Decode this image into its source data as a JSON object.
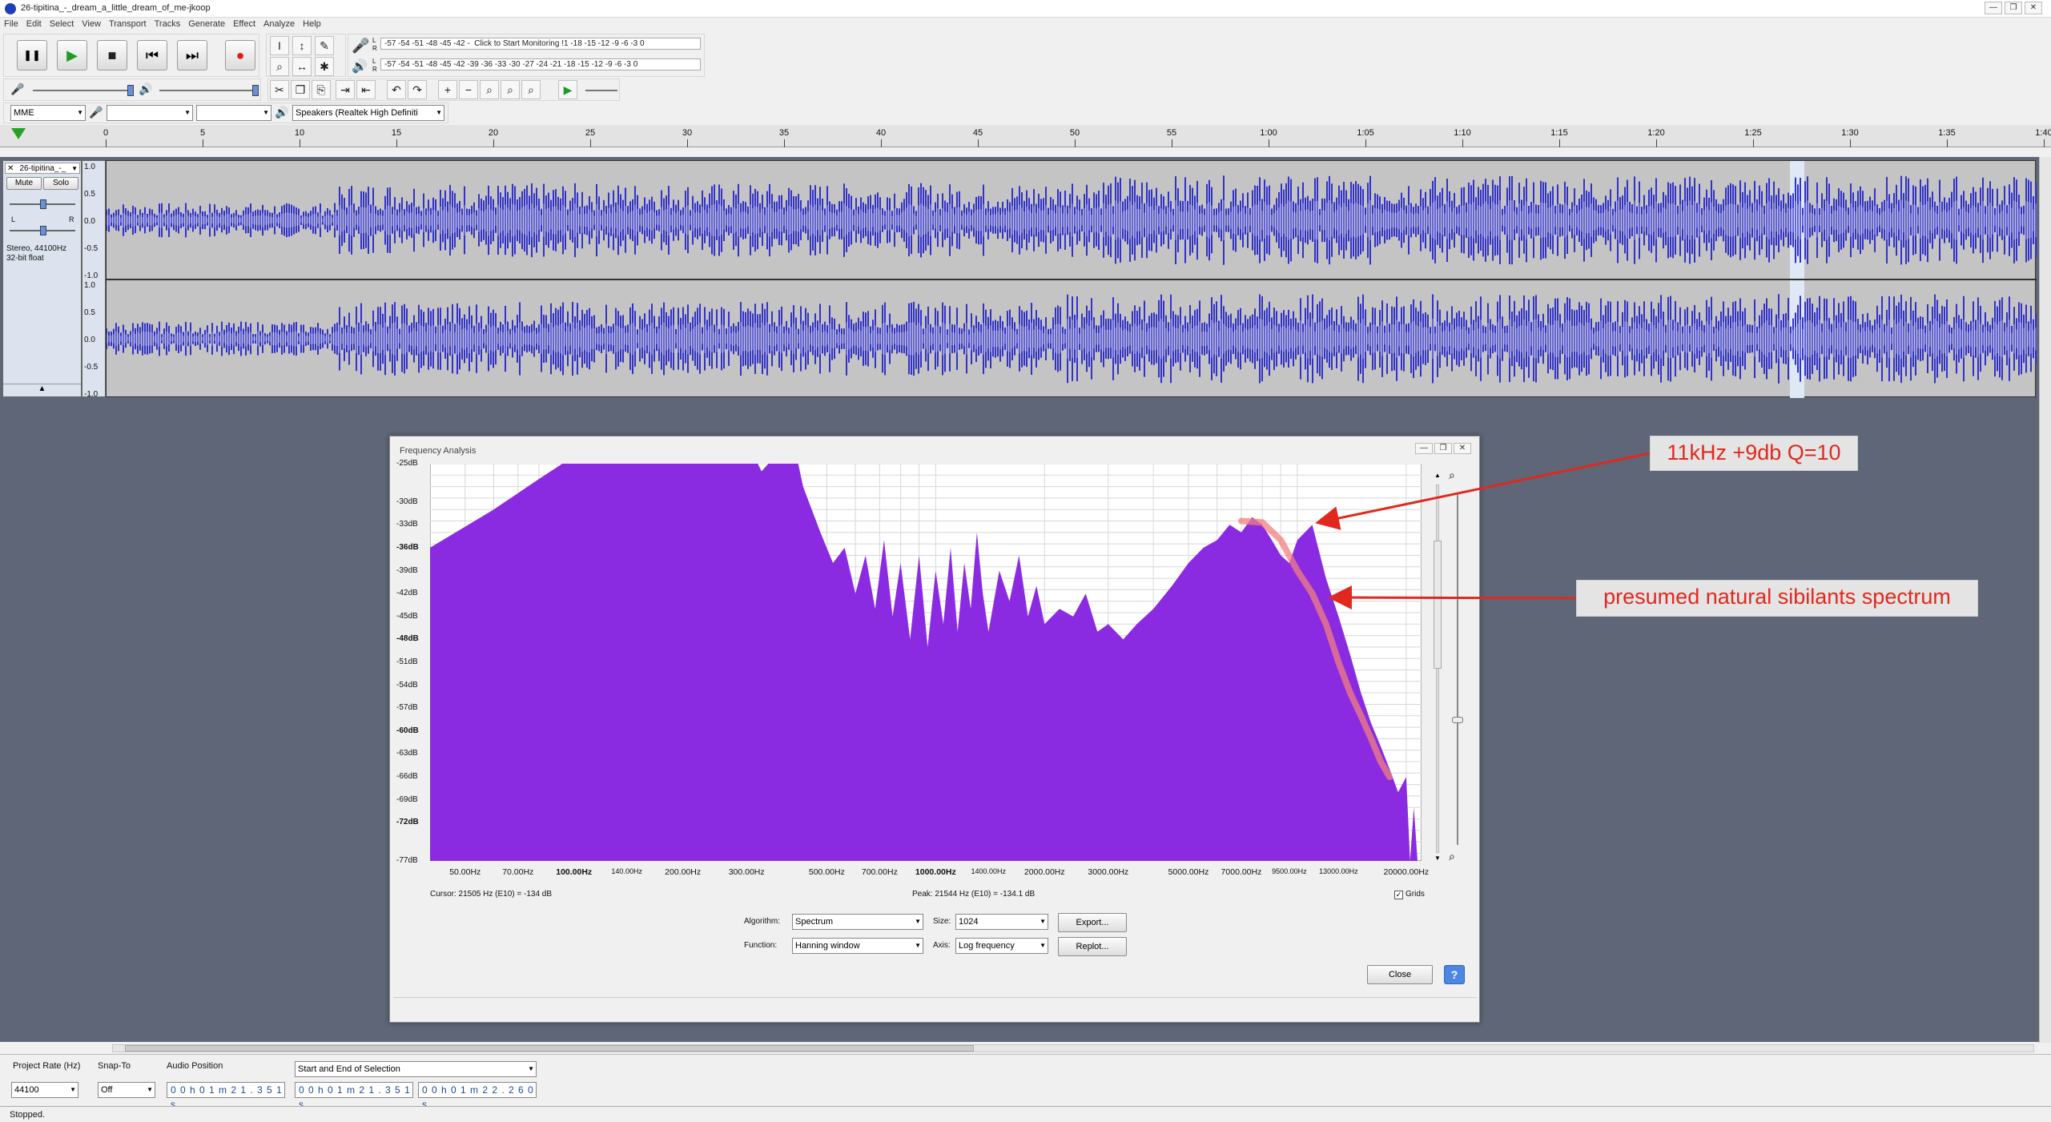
{
  "window": {
    "title": "26-tipitina_-_dream_a_little_dream_of_me-jkoop",
    "controls": [
      "—",
      "❐",
      "✕"
    ]
  },
  "menu": [
    "File",
    "Edit",
    "Select",
    "View",
    "Transport",
    "Tracks",
    "Generate",
    "Effect",
    "Analyze",
    "Help"
  ],
  "transport": {
    "pause": "❚❚",
    "play": "▶",
    "stop": "■",
    "skip_start": "⏮",
    "skip_end": "⏭",
    "record": "●"
  },
  "meters": {
    "record_scale": "-57 -54 -51 -48 -45 -42 -  Click to Start Monitoring !1 -18 -15 -12 -9 -6 -3 0",
    "play_scale": "-57 -54 -51 -48 -45 -42 -39 -36 -33 -30 -27 -24 -21 -18 -15 -12 -9 -6 -3 0",
    "L": "L",
    "R": "R"
  },
  "device": {
    "host": "MME",
    "playback": "Speakers (Realtek High Definiti"
  },
  "ruler": {
    "ticks": [
      "0",
      "5",
      "10",
      "15",
      "20",
      "25",
      "30",
      "35",
      "40",
      "45",
      "50",
      "55",
      "1:00",
      "1:05",
      "1:10",
      "1:15",
      "1:20",
      "1:25",
      "1:30",
      "1:35",
      "1:40"
    ]
  },
  "track": {
    "name": "26-tipitina_-_",
    "mute": "Mute",
    "solo": "Solo",
    "pan_l": "L",
    "pan_r": "R",
    "info1": "Stereo, 44100Hz",
    "info2": "32-bit float",
    "y_labels": [
      "1.0",
      "0.5",
      "0.0",
      "-0.5",
      "-1.0"
    ]
  },
  "freq": {
    "title": "Frequency Analysis",
    "db_labels": [
      "-25dB",
      "-30dB",
      "-33dB",
      "-36dB",
      "-39dB",
      "-42dB",
      "-45dB",
      "-48dB",
      "-51dB",
      "-54dB",
      "-57dB",
      "-60dB",
      "-63dB",
      "-66dB",
      "-69dB",
      "-72dB",
      "-77dB"
    ],
    "hz_labels": [
      "50.00Hz",
      "70.00Hz",
      "100.00Hz",
      "140.00Hz",
      "200.00Hz",
      "300.00Hz",
      "500.00Hz",
      "700.00Hz",
      "1000.00Hz",
      "1400.00Hz",
      "2000.00Hz",
      "3000.00Hz",
      "5000.00Hz",
      "7000.00Hz",
      "9500.00Hz",
      "13000.00Hz",
      "20000.00Hz"
    ],
    "cursor": "Cursor:  21505 Hz (E10) = -134 dB",
    "peak": "Peak:  21544 Hz (E10) = -134.1 dB",
    "grids": "Grids",
    "algorithm_label": "Algorithm:",
    "algorithm": "Spectrum",
    "size_label": "Size:",
    "size": "1024",
    "function_label": "Function:",
    "function": "Hanning window",
    "axis_label": "Axis:",
    "axis": "Log frequency",
    "export": "Export...",
    "replot": "Replot...",
    "close": "Close",
    "help": "?",
    "fill_color": "#8a2be2",
    "bg_color": "#ffffff"
  },
  "annotations": {
    "a1": "11kHz +9db Q=10",
    "a2": "presumed natural sibilants spectrum",
    "color": "#e1281e"
  },
  "bottom": {
    "rate_label": "Project Rate (Hz)",
    "rate": "44100",
    "snap_label": "Snap-To",
    "snap": "Off",
    "pos_label": "Audio Position",
    "pos": "0 0 h 0 1 m 2 1 . 3 5 1 s",
    "sel_mode": "Start and End of Selection",
    "sel_start": "0 0 h 0 1 m 2 1 . 3 5 1 s",
    "sel_end": "0 0 h 0 1 m 2 2 . 2 6 0 s"
  },
  "status": "Stopped.",
  "colors": {
    "waveform": "#3232c8",
    "waveform_rms": "#6464dc",
    "track_bg": "#5e6677",
    "selection": "#dfe8f7"
  }
}
